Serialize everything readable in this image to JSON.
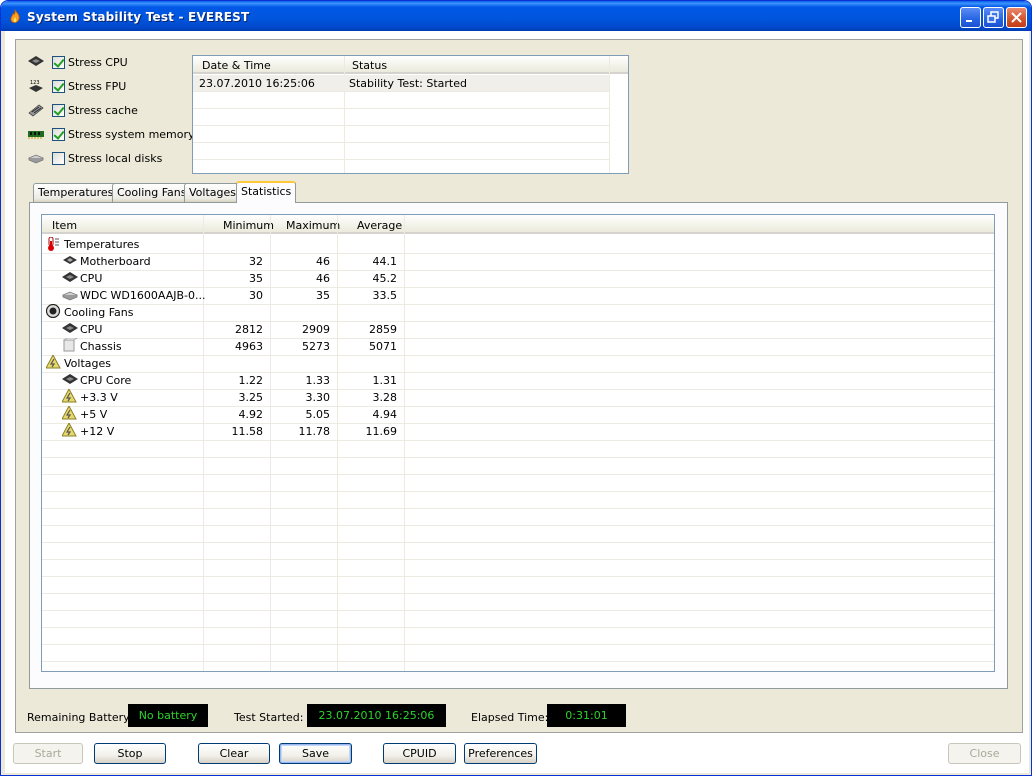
{
  "window": {
    "title": "System Stability Test - EVEREST"
  },
  "stress_options": [
    {
      "label": "Stress CPU",
      "checked": true,
      "icon": "cpu-icon"
    },
    {
      "label": "Stress FPU",
      "checked": true,
      "icon": "fpu-icon"
    },
    {
      "label": "Stress cache",
      "checked": true,
      "icon": "cache-icon"
    },
    {
      "label": "Stress system memory",
      "checked": true,
      "icon": "memory-icon"
    },
    {
      "label": "Stress local disks",
      "checked": false,
      "icon": "disk-icon"
    }
  ],
  "log": {
    "columns": [
      "Date & Time",
      "Status"
    ],
    "rows": [
      {
        "datetime": "23.07.2010 16:25:06",
        "status": "Stability Test: Started"
      }
    ]
  },
  "tabs": [
    "Temperatures",
    "Cooling Fans",
    "Voltages",
    "Statistics"
  ],
  "active_tab": "Statistics",
  "statistics": {
    "columns": [
      "Item",
      "Minimum",
      "Maximum",
      "Average"
    ],
    "rows": [
      {
        "label": "Temperatures",
        "group": true,
        "icon": "thermometer-icon"
      },
      {
        "label": "Motherboard",
        "min": "32",
        "max": "46",
        "avg": "44.1",
        "icon": "motherboard-icon"
      },
      {
        "label": "CPU",
        "min": "35",
        "max": "46",
        "avg": "45.2",
        "icon": "cpu-icon"
      },
      {
        "label": "WDC WD1600AAJB-0...",
        "min": "30",
        "max": "35",
        "avg": "33.5",
        "icon": "disk-icon"
      },
      {
        "label": "Cooling Fans",
        "group": true,
        "icon": "fan-icon"
      },
      {
        "label": "CPU",
        "min": "2812",
        "max": "2909",
        "avg": "2859",
        "icon": "cpu-icon"
      },
      {
        "label": "Chassis",
        "min": "4963",
        "max": "5273",
        "avg": "5071",
        "icon": "chassis-icon"
      },
      {
        "label": "Voltages",
        "group": true,
        "icon": "voltage-icon"
      },
      {
        "label": "CPU Core",
        "min": "1.22",
        "max": "1.33",
        "avg": "1.31",
        "icon": "cpu-icon"
      },
      {
        "label": "+3.3 V",
        "min": "3.25",
        "max": "3.30",
        "avg": "3.28",
        "icon": "voltage-icon"
      },
      {
        "label": "+5 V",
        "min": "4.92",
        "max": "5.05",
        "avg": "4.94",
        "icon": "voltage-icon"
      },
      {
        "label": "+12 V",
        "min": "11.58",
        "max": "11.78",
        "avg": "11.69",
        "icon": "voltage-icon"
      }
    ]
  },
  "status_bar": {
    "battery_label": "Remaining Battery:",
    "battery_value": "No battery",
    "started_label": "Test Started:",
    "started_value": "23.07.2010 16:25:06",
    "elapsed_label": "Elapsed Time:",
    "elapsed_value": "0:31:01"
  },
  "buttons": {
    "start": "Start",
    "stop": "Stop",
    "clear": "Clear",
    "save": "Save",
    "cpuid": "CPUID",
    "preferences": "Preferences",
    "close": "Close"
  },
  "colors": {
    "titlebar": "#0055dd",
    "status_text": "#2bd42b",
    "tab_accent": "#ffc83c"
  }
}
